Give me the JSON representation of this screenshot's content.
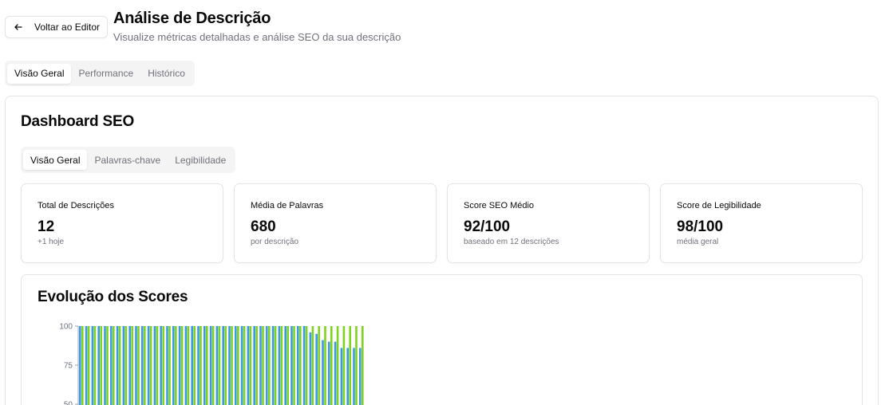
{
  "header": {
    "back_label": "Voltar ao Editor",
    "title": "Análise de Descrição",
    "subtitle": "Visualize métricas detalhadas e análise SEO da sua descrição"
  },
  "top_tabs": [
    {
      "label": "Visão Geral",
      "active": true
    },
    {
      "label": "Performance",
      "active": false
    },
    {
      "label": "Histórico",
      "active": false
    }
  ],
  "dashboard": {
    "title": "Dashboard SEO",
    "tabs": [
      {
        "label": "Visão Geral",
        "active": true
      },
      {
        "label": "Palavras-chave",
        "active": false
      },
      {
        "label": "Legibilidade",
        "active": false
      }
    ],
    "stats": [
      {
        "label": "Total de Descrições",
        "value": "12",
        "note": "+1 hoje"
      },
      {
        "label": "Média de Palavras",
        "value": "680",
        "note": "por descrição"
      },
      {
        "label": "Score SEO Médio",
        "value": "92/100",
        "note": "baseado em 12 descrições"
      },
      {
        "label": "Score de Legibilidade",
        "value": "98/100",
        "note": "média geral"
      }
    ]
  },
  "chart_data": {
    "type": "bar",
    "title": "Evolução dos Scores",
    "y_ticks": [
      "100",
      "75",
      "50"
    ],
    "ylim": [
      50,
      100
    ],
    "colors": {
      "seo": "#3b9ae1",
      "legibilidade": "#7ed321"
    },
    "series": [
      {
        "values": [
          100,
          100,
          100,
          100,
          100,
          100,
          100,
          100,
          100,
          100,
          100,
          100,
          100,
          100,
          100,
          100,
          100,
          100,
          100,
          100,
          100,
          100,
          100,
          100,
          100,
          100,
          100,
          100,
          100,
          100,
          100,
          100,
          100,
          100,
          100,
          100,
          100,
          96,
          95,
          91,
          90,
          90,
          86,
          86,
          86,
          86
        ]
      },
      {
        "values": [
          100,
          100,
          100,
          100,
          100,
          100,
          100,
          100,
          100,
          100,
          100,
          100,
          100,
          100,
          100,
          100,
          100,
          100,
          100,
          100,
          100,
          100,
          100,
          100,
          100,
          100,
          100,
          100,
          100,
          100,
          100,
          100,
          100,
          100,
          100,
          100,
          100,
          100,
          100,
          100,
          100,
          100,
          100,
          100,
          100,
          100
        ]
      }
    ]
  }
}
